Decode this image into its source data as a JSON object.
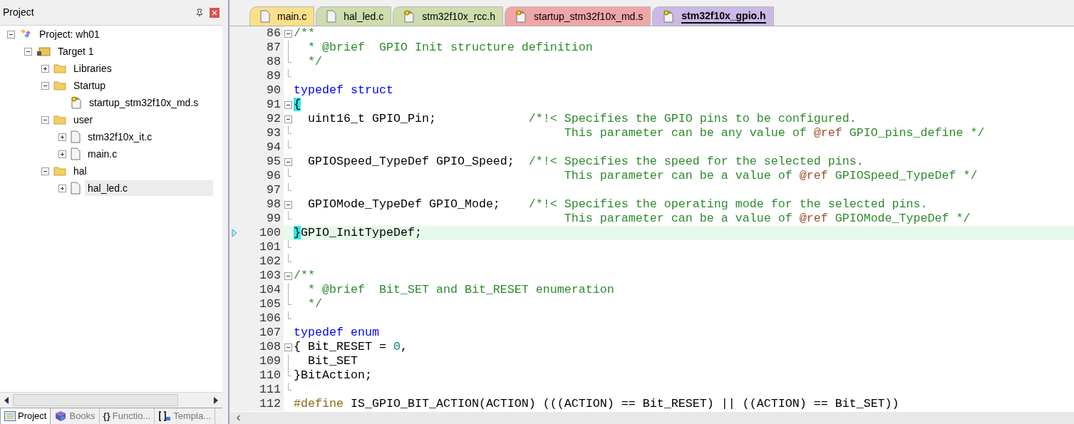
{
  "project_panel": {
    "title": "Project",
    "tree": [
      {
        "label": "Project: wh01",
        "kind": "project",
        "expanded": true,
        "selected": false,
        "children": [
          {
            "label": "Target 1",
            "kind": "target",
            "expanded": true,
            "selected": false,
            "children": [
              {
                "label": "Libraries",
                "kind": "folder",
                "expanded": false,
                "selected": false
              },
              {
                "label": "Startup",
                "kind": "folder",
                "expanded": true,
                "selected": false,
                "children": [
                  {
                    "label": "startup_stm32f10x_md.s",
                    "kind": "asm-file",
                    "selected": false
                  }
                ]
              },
              {
                "label": "user",
                "kind": "folder",
                "expanded": true,
                "selected": false,
                "children": [
                  {
                    "label": "stm32f10x_it.c",
                    "kind": "file",
                    "expanded": false,
                    "selected": false
                  },
                  {
                    "label": "main.c",
                    "kind": "file",
                    "expanded": false,
                    "selected": false
                  }
                ]
              },
              {
                "label": "hal",
                "kind": "folder",
                "expanded": true,
                "selected": false,
                "children": [
                  {
                    "label": "hal_led.c",
                    "kind": "file",
                    "expanded": false,
                    "selected": true
                  }
                ]
              }
            ]
          }
        ]
      }
    ],
    "bottom_tabs": [
      {
        "label": "Project",
        "kind": "project",
        "selected": true
      },
      {
        "label": "Books",
        "kind": "book",
        "selected": false
      },
      {
        "label": "Functio...",
        "kind": "glyph",
        "glyph": "{}",
        "selected": false
      },
      {
        "label": "Templa...",
        "kind": "template",
        "selected": false
      }
    ]
  },
  "editor": {
    "tabs": [
      {
        "label": "main.c",
        "kind": "file",
        "color": "#fbe08a",
        "selected": false
      },
      {
        "label": "hal_led.c",
        "kind": "file",
        "color": "#cfdcae",
        "selected": false
      },
      {
        "label": "stm32f10x_rcc.h",
        "kind": "key-file",
        "color": "#cfdcae",
        "selected": false
      },
      {
        "label": "startup_stm32f10x_md.s",
        "kind": "key-file",
        "color": "#f0a6a6",
        "selected": false
      },
      {
        "label": "stm32f10x_gpio.h",
        "kind": "key-file",
        "color": "#cbb8e6",
        "selected": true
      }
    ],
    "lines": [
      {
        "number": "86",
        "kind": "fold-box",
        "current": false,
        "tokens": [
          {
            "kind": "comment",
            "text": "/**"
          }
        ]
      },
      {
        "number": "87",
        "kind": "fold-line",
        "current": false,
        "tokens": [
          {
            "kind": "comment",
            "text": "  * @brief  GPIO Init structure definition"
          }
        ]
      },
      {
        "number": "88",
        "kind": "fold-end",
        "current": false,
        "tokens": [
          {
            "kind": "comment",
            "text": "  */"
          }
        ]
      },
      {
        "number": "89",
        "kind": "fold-end",
        "current": false
      },
      {
        "number": "90",
        "kind": "plain",
        "current": false,
        "tokens": [
          {
            "kind": "keyword",
            "text": "typedef struct"
          }
        ]
      },
      {
        "number": "91",
        "kind": "fold-box",
        "current": false,
        "tokens": [
          {
            "kind": "brace-match",
            "text": "{"
          }
        ]
      },
      {
        "number": "92",
        "kind": "fold-box",
        "current": false,
        "tokens": [
          {
            "kind": "plain",
            "text": "  uint16_t GPIO_Pin;             "
          },
          {
            "kind": "comment",
            "text": "/*!< Specifies the GPIO pins to be configured."
          }
        ]
      },
      {
        "number": "93",
        "kind": "fold-end",
        "current": false,
        "tokens": [
          {
            "kind": "comment",
            "text": "                                      This parameter can be any value of "
          },
          {
            "kind": "doc-tag",
            "text": "@ref"
          },
          {
            "kind": "comment",
            "text": " GPIO_pins_define */"
          }
        ]
      },
      {
        "number": "94",
        "kind": "fold-end",
        "current": false
      },
      {
        "number": "95",
        "kind": "fold-box",
        "current": false,
        "tokens": [
          {
            "kind": "plain",
            "text": "  GPIOSpeed_TypeDef GPIO_Speed;  "
          },
          {
            "kind": "comment",
            "text": "/*!< Specifies the speed for the selected pins."
          }
        ]
      },
      {
        "number": "96",
        "kind": "fold-end",
        "current": false,
        "tokens": [
          {
            "kind": "comment",
            "text": "                                      This parameter can be a value of "
          },
          {
            "kind": "doc-tag",
            "text": "@ref"
          },
          {
            "kind": "comment",
            "text": " GPIOSpeed_TypeDef */"
          }
        ]
      },
      {
        "number": "97",
        "kind": "fold-end",
        "current": false
      },
      {
        "number": "98",
        "kind": "fold-box",
        "current": false,
        "tokens": [
          {
            "kind": "plain",
            "text": "  GPIOMode_TypeDef GPIO_Mode;    "
          },
          {
            "kind": "comment",
            "text": "/*!< Specifies the operating mode for the selected pins."
          }
        ]
      },
      {
        "number": "99",
        "kind": "fold-end",
        "current": false,
        "tokens": [
          {
            "kind": "comment",
            "text": "                                      This parameter can be a value of "
          },
          {
            "kind": "doc-tag",
            "text": "@ref"
          },
          {
            "kind": "comment",
            "text": " GPIOMode_TypeDef */"
          }
        ]
      },
      {
        "number": "100",
        "kind": "plain",
        "current": true,
        "tokens": [
          {
            "kind": "brace-match",
            "text": "}"
          },
          {
            "kind": "plain",
            "text": "GPIO_InitTypeDef;"
          }
        ]
      },
      {
        "number": "101",
        "kind": "fold-end",
        "current": false
      },
      {
        "number": "102",
        "kind": "fold-end",
        "current": false
      },
      {
        "number": "103",
        "kind": "fold-box",
        "current": false,
        "tokens": [
          {
            "kind": "comment",
            "text": "/**"
          }
        ]
      },
      {
        "number": "104",
        "kind": "fold-line",
        "current": false,
        "tokens": [
          {
            "kind": "comment",
            "text": "  * @brief  Bit_SET and Bit_RESET enumeration"
          }
        ]
      },
      {
        "number": "105",
        "kind": "fold-end",
        "current": false,
        "tokens": [
          {
            "kind": "comment",
            "text": "  */"
          }
        ]
      },
      {
        "number": "106",
        "kind": "fold-end",
        "current": false
      },
      {
        "number": "107",
        "kind": "plain",
        "current": false,
        "tokens": [
          {
            "kind": "keyword",
            "text": "typedef enum"
          }
        ]
      },
      {
        "number": "108",
        "kind": "fold-box",
        "current": false,
        "tokens": [
          {
            "kind": "plain",
            "text": "{ Bit_RESET = "
          },
          {
            "kind": "number",
            "text": "0"
          },
          {
            "kind": "plain",
            "text": ","
          }
        ]
      },
      {
        "number": "109",
        "kind": "fold-line",
        "current": false,
        "tokens": [
          {
            "kind": "plain",
            "text": "  Bit_SET"
          }
        ]
      },
      {
        "number": "110",
        "kind": "fold-end",
        "current": false,
        "tokens": [
          {
            "kind": "plain",
            "text": "}BitAction;"
          }
        ]
      },
      {
        "number": "111",
        "kind": "fold-end",
        "current": false
      },
      {
        "number": "112",
        "kind": "plain",
        "current": false,
        "tokens": [
          {
            "kind": "preprocessor",
            "text": "#define"
          },
          {
            "kind": "plain",
            "text": " IS_GPIO_BIT_ACTION(ACTION) (((ACTION) == Bit_RESET) || ((ACTION) == Bit_SET))"
          }
        ]
      }
    ]
  }
}
